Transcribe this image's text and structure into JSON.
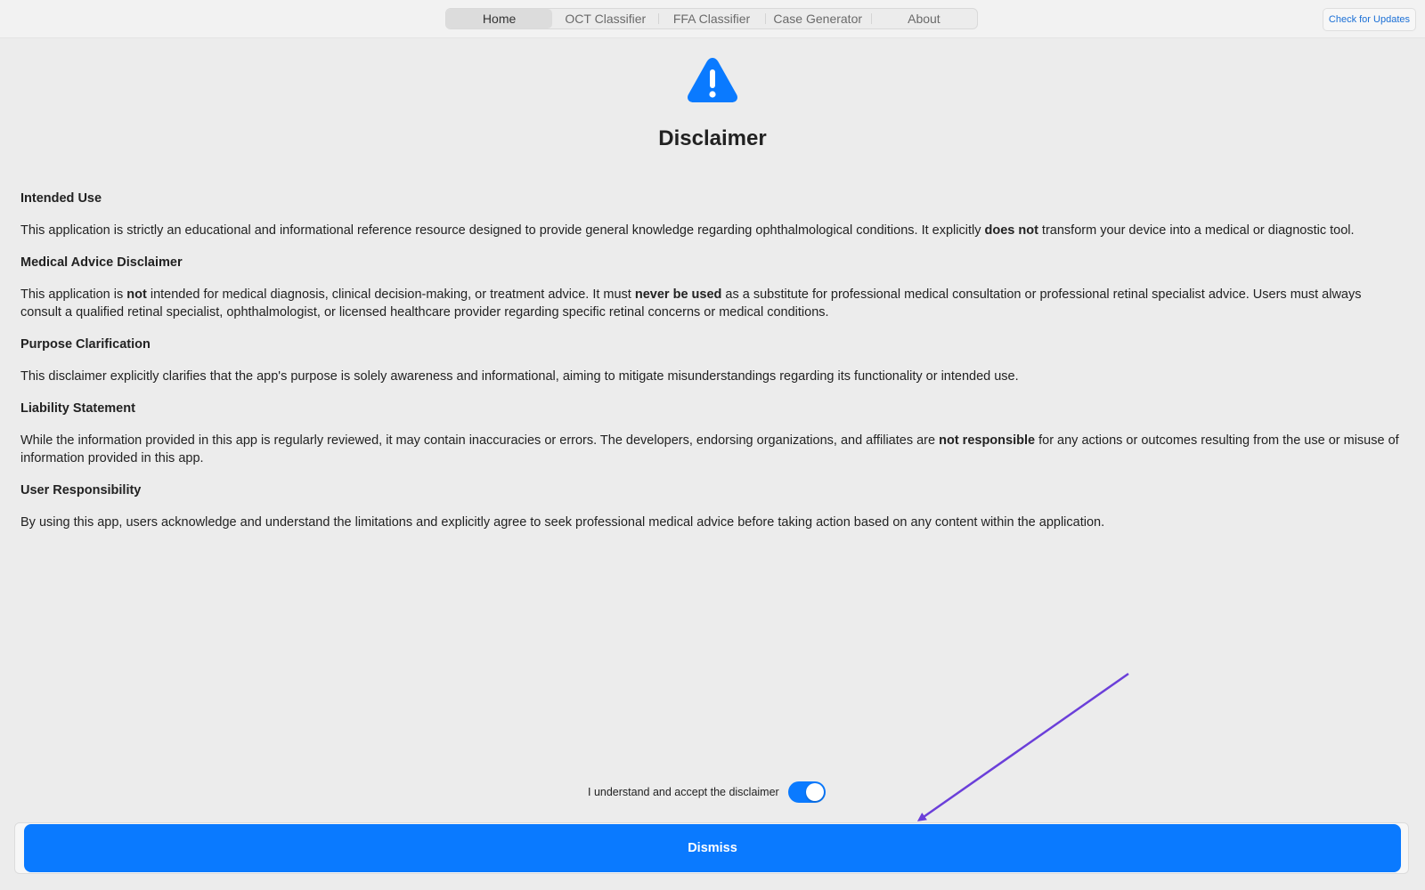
{
  "toolbar": {
    "tabs": [
      {
        "label": "Home",
        "active": true
      },
      {
        "label": "OCT Classifier",
        "active": false
      },
      {
        "label": "FFA Classifier",
        "active": false
      },
      {
        "label": "Case Generator",
        "active": false
      },
      {
        "label": "About",
        "active": false
      }
    ],
    "check_updates_label": "Check for Updates"
  },
  "header": {
    "icon": "warning-triangle-icon",
    "title": "Disclaimer"
  },
  "sections": [
    {
      "heading": "Intended Use",
      "parts": [
        {
          "text": "This application is strictly an educational and informational reference resource designed to provide general knowledge regarding ophthalmological conditions. It explicitly ",
          "bold": false
        },
        {
          "text": "does not",
          "bold": true
        },
        {
          "text": " transform your device into a medical or diagnostic tool.",
          "bold": false
        }
      ]
    },
    {
      "heading": "Medical Advice Disclaimer",
      "parts": [
        {
          "text": "This application is ",
          "bold": false
        },
        {
          "text": "not",
          "bold": true
        },
        {
          "text": " intended for medical diagnosis, clinical decision-making, or treatment advice. It must ",
          "bold": false
        },
        {
          "text": "never be used",
          "bold": true
        },
        {
          "text": " as a substitute for professional medical consultation or professional retinal specialist advice. Users must always consult a qualified retinal specialist, ophthalmologist, or licensed healthcare provider regarding specific retinal concerns or medical conditions.",
          "bold": false
        }
      ]
    },
    {
      "heading": "Purpose Clarification",
      "parts": [
        {
          "text": "This disclaimer explicitly clarifies that the app's purpose is solely awareness and informational, aiming to mitigate misunderstandings regarding its functionality or intended use.",
          "bold": false
        }
      ]
    },
    {
      "heading": "Liability Statement",
      "parts": [
        {
          "text": "While the information provided in this app is regularly reviewed, it may contain inaccuracies or errors. The developers, endorsing organizations, and affiliates are ",
          "bold": false
        },
        {
          "text": "not responsible",
          "bold": true
        },
        {
          "text": " for any actions or outcomes resulting from the use or misuse of information provided in this app.",
          "bold": false
        }
      ]
    },
    {
      "heading": "User Responsibility",
      "parts": [
        {
          "text": "By using this app, users acknowledge and understand the limitations and explicitly agree to seek professional medical advice before taking action based on any content within the application.",
          "bold": false
        }
      ]
    }
  ],
  "footer": {
    "accept_label": "I understand and accept the disclaimer",
    "accept_toggle_on": true,
    "dismiss_label": "Dismiss"
  },
  "colors": {
    "accent": "#0a7aff",
    "annotation_arrow": "#6b3fd9",
    "background": "#ececec"
  }
}
